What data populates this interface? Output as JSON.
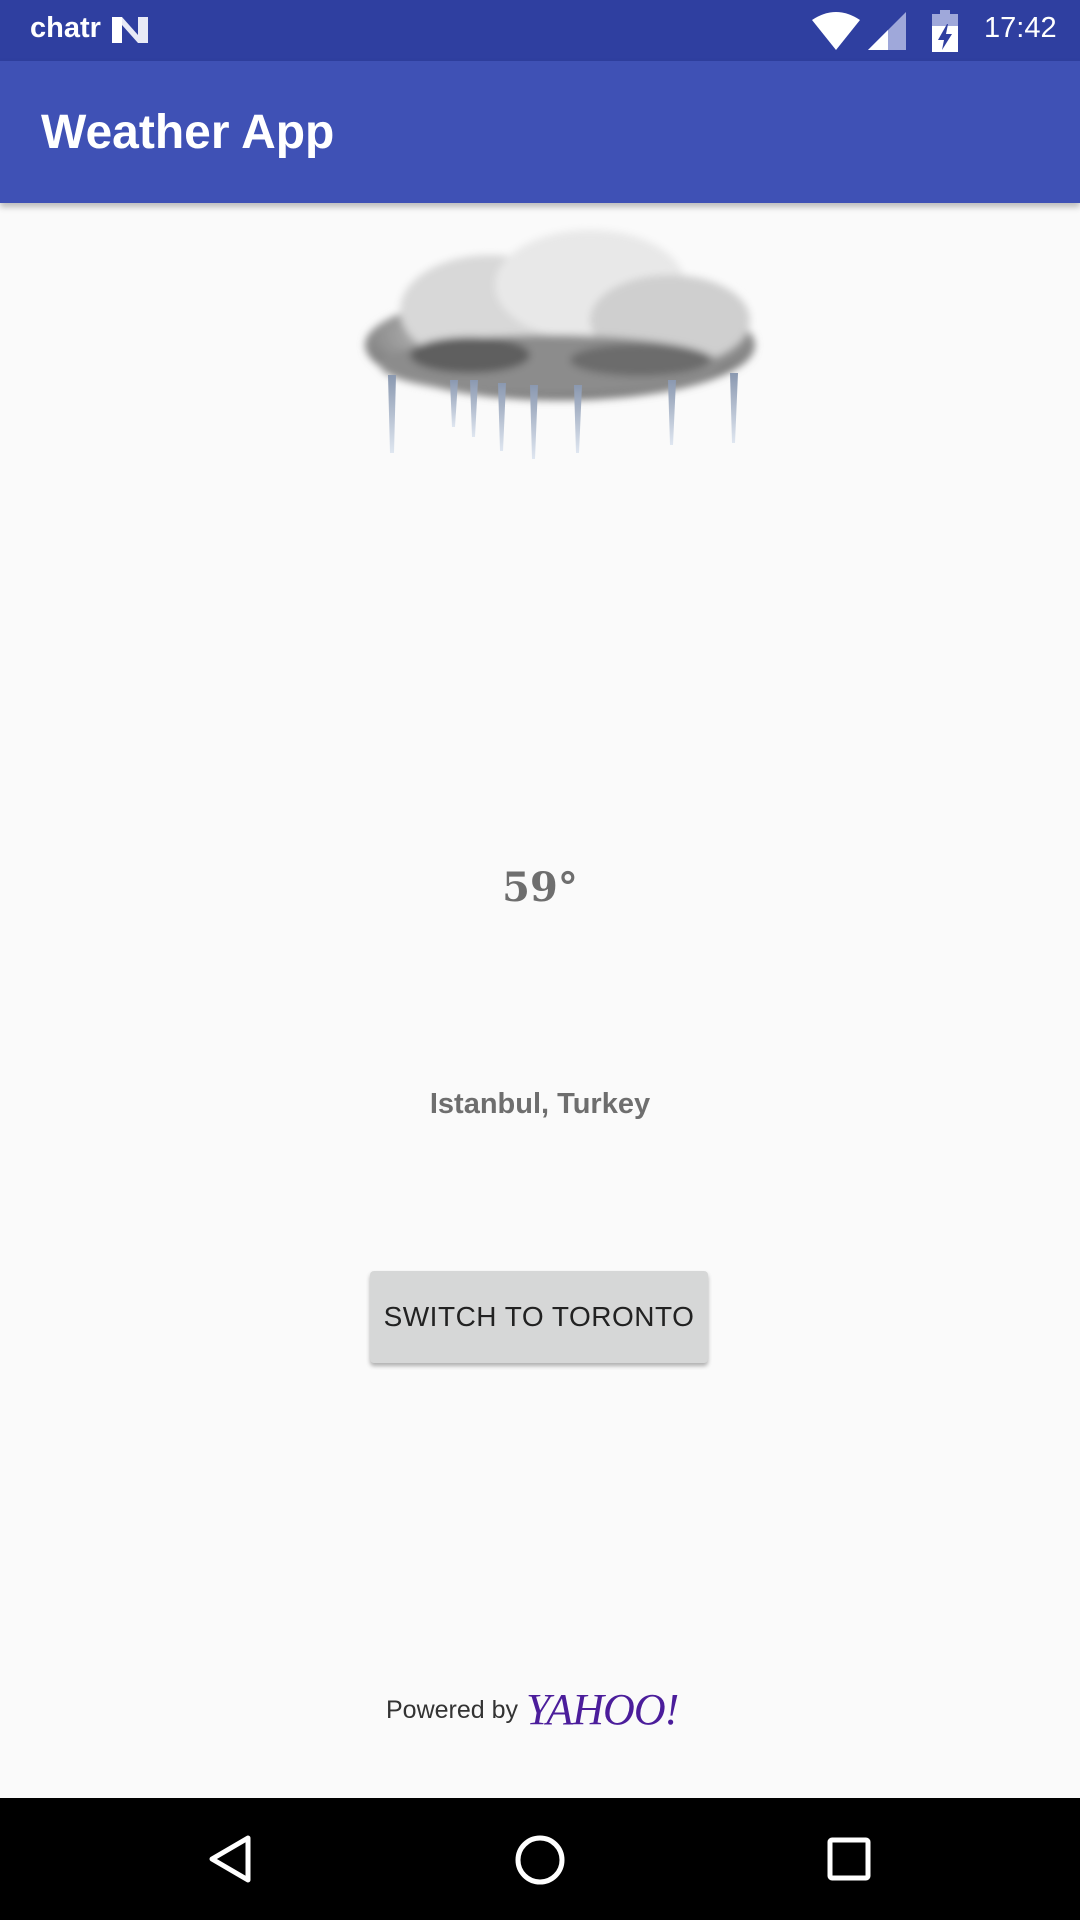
{
  "status_bar": {
    "carrier": "chatr",
    "time": "17:42",
    "icons": [
      "n-notification-icon",
      "wifi-icon",
      "signal-icon",
      "battery-charging-icon"
    ]
  },
  "app_bar": {
    "title": "Weather App"
  },
  "weather": {
    "icon": "sleet-cloud-icon",
    "temperature": "59°",
    "location": "Istanbul, Turkey"
  },
  "actions": {
    "switch_button_label": "SWITCH TO TORONTO"
  },
  "footer": {
    "powered_by": "Powered by",
    "provider": "YAHOO!"
  },
  "nav_bar": {
    "icons": [
      "back-icon",
      "home-icon",
      "recents-icon"
    ]
  },
  "colors": {
    "status_bar": "#2f3fa0",
    "app_bar": "#3f51b5",
    "background": "#fafafa",
    "button": "#d6d7d7",
    "yahoo_purple": "#4b1d9b",
    "text_gray": "#6e6e6e"
  }
}
